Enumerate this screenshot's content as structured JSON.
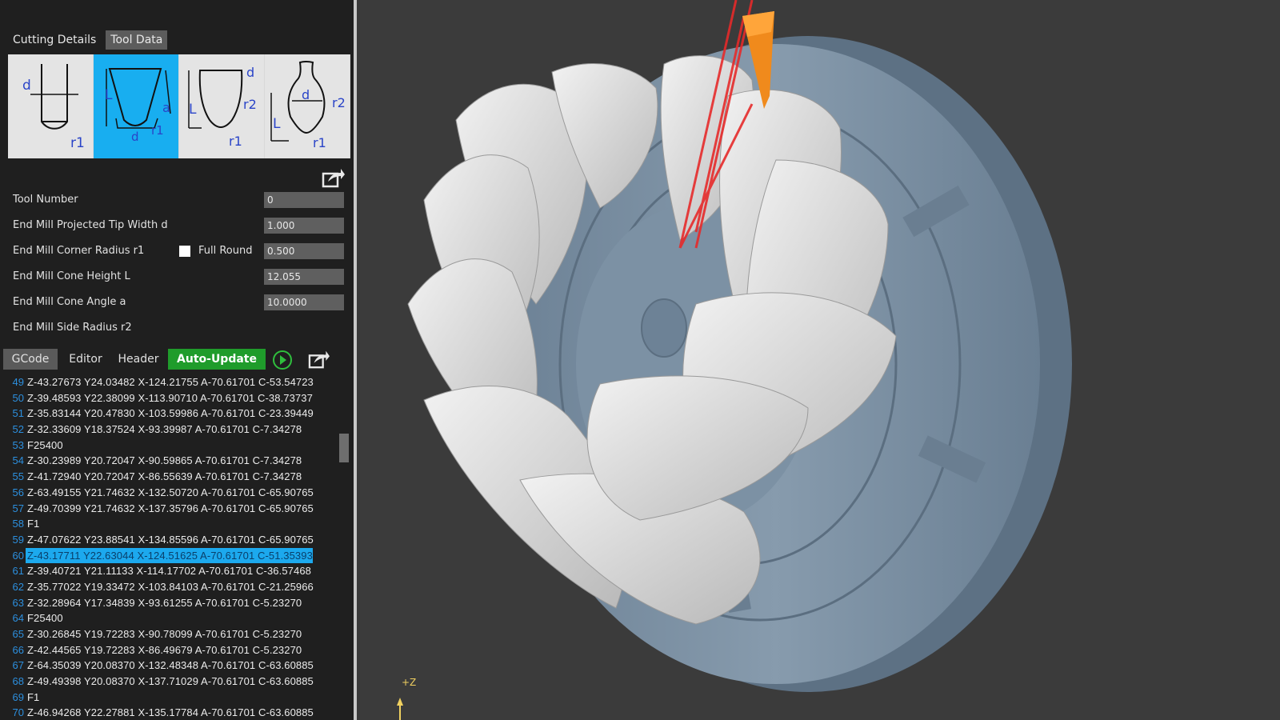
{
  "panel": {
    "tabs": [
      {
        "label": "Cutting Details",
        "active": false
      },
      {
        "label": "Tool Data",
        "active": true
      }
    ],
    "tool_shapes": [
      {
        "name": "ball-end-mill",
        "labels": {
          "d": "d",
          "r1": "r1"
        },
        "selected": false
      },
      {
        "name": "tapered-end-mill",
        "labels": {
          "L": "L",
          "a": "a",
          "d": "d",
          "r1": "r1"
        },
        "selected": true
      },
      {
        "name": "barrel-tool",
        "labels": {
          "d": "d",
          "L": "L",
          "r1": "r1",
          "r2": "r2"
        },
        "selected": false
      },
      {
        "name": "lens-tool",
        "labels": {
          "d": "d",
          "L": "L",
          "r1": "r1",
          "r2": "r2"
        },
        "selected": false
      }
    ],
    "params": [
      {
        "label": "Tool Number",
        "value": "0"
      },
      {
        "label": "End Mill Projected Tip Width d",
        "value": "1.000"
      },
      {
        "label": "End Mill Corner Radius r1",
        "value": "0.500",
        "checkbox_label": "Full Round"
      },
      {
        "label": "End Mill Cone Height L",
        "value": "12.055"
      },
      {
        "label": "End Mill Cone Angle a",
        "value": "10.0000"
      },
      {
        "label": "End Mill Side Radius r2",
        "value": ""
      }
    ],
    "code_tabs": [
      "GCode",
      "Editor",
      "Header",
      "Auto-Update"
    ],
    "active_code_tab": "GCode",
    "highlight_line": 60,
    "code_lines": [
      {
        "n": "49",
        "text": "Z-43.27673 Y24.03482 X-124.21755 A-70.61701 C-53.54723"
      },
      {
        "n": "50",
        "text": "Z-39.48593 Y22.38099 X-113.90710 A-70.61701 C-38.73737"
      },
      {
        "n": "51",
        "text": "Z-35.83144 Y20.47830 X-103.59986 A-70.61701 C-23.39449"
      },
      {
        "n": "52",
        "text": "Z-32.33609 Y18.37524 X-93.39987 A-70.61701 C-7.34278"
      },
      {
        "n": "53",
        "text": "F25400"
      },
      {
        "n": "54",
        "text": "Z-30.23989 Y20.72047 X-90.59865 A-70.61701 C-7.34278"
      },
      {
        "n": "55",
        "text": "Z-41.72940 Y20.72047 X-86.55639 A-70.61701 C-7.34278"
      },
      {
        "n": "56",
        "text": "Z-63.49155 Y21.74632 X-132.50720 A-70.61701 C-65.90765"
      },
      {
        "n": "57",
        "text": "Z-49.70399 Y21.74632 X-137.35796 A-70.61701 C-65.90765"
      },
      {
        "n": "58",
        "text": "F1"
      },
      {
        "n": "59",
        "text": "Z-47.07622 Y23.88541 X-134.85596 A-70.61701 C-65.90765"
      },
      {
        "n": "60",
        "text": "Z-43.17711 Y22.63044 X-124.51625 A-70.61701 C-51.35393"
      },
      {
        "n": "61",
        "text": "Z-39.40721 Y21.11133 X-114.17702 A-70.61701 C-36.57468"
      },
      {
        "n": "62",
        "text": "Z-35.77022 Y19.33472 X-103.84103 A-70.61701 C-21.25966"
      },
      {
        "n": "63",
        "text": "Z-32.28964 Y17.34839 X-93.61255 A-70.61701 C-5.23270"
      },
      {
        "n": "64",
        "text": "F25400"
      },
      {
        "n": "65",
        "text": "Z-30.26845 Y19.72283 X-90.78099 A-70.61701 C-5.23270"
      },
      {
        "n": "66",
        "text": "Z-42.44565 Y19.72283 X-86.49679 A-70.61701 C-5.23270"
      },
      {
        "n": "67",
        "text": "Z-64.35039 Y20.08370 X-132.48348 A-70.61701 C-63.60885"
      },
      {
        "n": "68",
        "text": "Z-49.49398 Y20.08370 X-137.71029 A-70.61701 C-63.60885"
      },
      {
        "n": "69",
        "text": "F1"
      },
      {
        "n": "70",
        "text": "Z-46.94268 Y22.27881 X-135.17784 A-70.61701 C-63.60885"
      }
    ]
  },
  "viewport": {
    "axis_label": "+Z",
    "colors": {
      "gear": "#e6e6e6",
      "fixture": "#7f94a7",
      "tool": "#f08a1c",
      "toolpath": "#e52a2a",
      "background": "#3b3b3b"
    }
  },
  "icons": {
    "export": "export-icon",
    "play": "play-circle-icon"
  }
}
